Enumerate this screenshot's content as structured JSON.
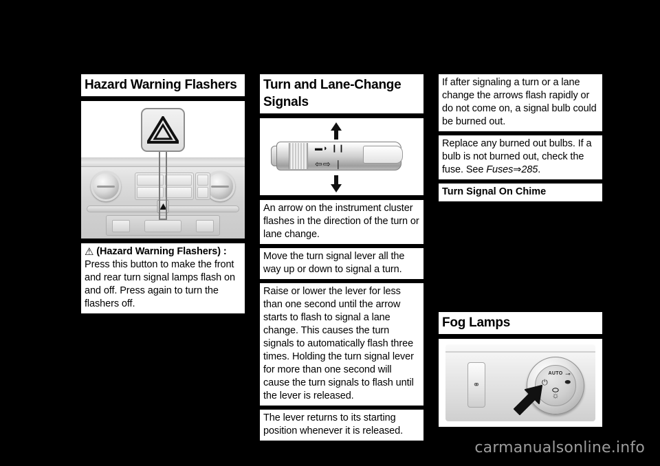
{
  "page": {
    "background_color": "#000000",
    "watermark": "carmanualsonline.info"
  },
  "left_column": {
    "heading": "Hazard Warning Flashers",
    "figure": {
      "name": "hazard-flasher-button-figure",
      "caption": "Center stack with hazard warning flashers button called out",
      "callout_icon": "hazard-triangle-icon"
    },
    "blocks": [
      {
        "icon": "hazard-triangle-icon",
        "bold_label": "(Hazard Warning Flashers) :",
        "text": "Press this button to make the front and rear turn signal lamps flash on and off. Press again to turn the flashers off."
      }
    ]
  },
  "middle_column": {
    "heading": "Turn and Lane-Change Signals",
    "figure": {
      "name": "turn-signal-lever-figure",
      "caption": "Turn signal lever with up and down arrows",
      "marks_row_1": "▬◗ ❙❙",
      "marks_row_2": "⇦⇨ ❘"
    },
    "blocks": [
      {
        "text": "An arrow on the instrument cluster flashes in the direction of the turn or lane change."
      },
      {
        "text": "Move the turn signal lever all the way up or down to signal a turn."
      },
      {
        "text": "Raise or lower the lever for less than one second until the arrow starts to flash to signal a lane change. This causes the turn signals to automatically flash three times. Holding the turn signal lever for more than one second will cause the turn signals to flash until the lever is released."
      },
      {
        "text": "The lever returns to its starting position whenever it is released."
      }
    ]
  },
  "right_column": {
    "blocks": [
      {
        "text": "If after signaling a turn or a lane change the arrows flash rapidly or do not come on, a signal bulb could be burned out."
      }
    ],
    "replace_block": {
      "text_before": "Replace any burned out bulbs. If a bulb is not burned out, check the fuse. See ",
      "cross_reference": "Fuses",
      "cross_reference_arrow": "⇒",
      "page_number": "285",
      "text_after": "."
    },
    "subheading": "Turn Signal On Chime",
    "fog_heading": "Fog Lamps",
    "fog_figure": {
      "name": "fog-lamp-control-figure",
      "caption": "Headlamp control dial with fog lamp position indicated by arrow",
      "dial_auto_label": "AUTO",
      "dial_headlamp_icon": "headlamp-icon",
      "dial_off_icon": "power-off-icon",
      "dial_lamp_icon": "low-beam-icon",
      "dial_fog_icon": "fog-lamp-icon",
      "dial_park_icon": "parking-lamp-icon",
      "rocker_icon": "dome-lamp-icon"
    }
  }
}
